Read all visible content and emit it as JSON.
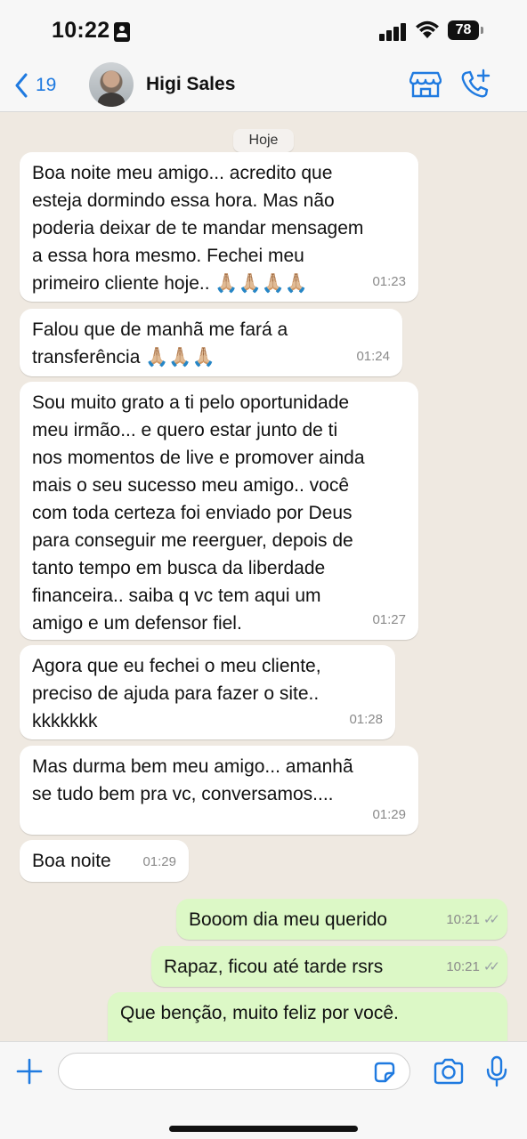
{
  "status_bar": {
    "time": "10:22",
    "battery": "78"
  },
  "header": {
    "back_count": "19",
    "contact_name": "Higi Sales"
  },
  "chat": {
    "date_label": "Hoje",
    "messages": [
      {
        "text": "Boa noite meu amigo... acredito que\nesteja dormindo essa hora. Mas não\npoderia deixar de te mandar mensagem\na essa hora mesmo. Fechei meu\nprimeiro cliente hoje.. 🙏🏼🙏🏼🙏🏼🙏🏼",
        "time": "01:23"
      },
      {
        "text": "Falou que de manhã me fará a\ntransferência 🙏🏼🙏🏼🙏🏼",
        "time": "01:24"
      },
      {
        "text": "Sou muito grato a ti pelo oportunidade\nmeu irmão... e quero estar junto de ti\nnos momentos de live e promover ainda\nmais o seu sucesso meu amigo.. você\ncom toda certeza foi enviado por Deus\npara conseguir me reerguer, depois de\ntanto tempo em busca da liberdade\nfinanceira.. saiba q vc tem aqui um\namigo e um defensor fiel.",
        "time": "01:27"
      },
      {
        "text": "Agora que eu fechei o meu cliente,\npreciso de ajuda para fazer o site..\nkkkkkkk",
        "time": "01:28"
      },
      {
        "text": "Mas durma bem meu amigo... amanhã\nse tudo bem pra vc, conversamos....",
        "time": "01:29"
      },
      {
        "text": "Boa noite",
        "time": "01:29"
      },
      {
        "text": "Booom dia meu querido",
        "time": "10:21"
      },
      {
        "text": "Rapaz, ficou até tarde rsrs",
        "time": "10:21"
      },
      {
        "text": "Que benção, muito feliz por você.",
        "time": ""
      }
    ]
  },
  "input": {
    "placeholder": ""
  },
  "colors": {
    "accent": "#1f7ae0",
    "outgoing_bubble": "#dcf8c6",
    "chat_background": "#efe9e1"
  },
  "icons": [
    "back-chevron-icon",
    "store-icon",
    "call-add-icon",
    "plus-icon",
    "sticker-icon",
    "camera-icon",
    "mic-icon",
    "read-ticks-icon"
  ]
}
